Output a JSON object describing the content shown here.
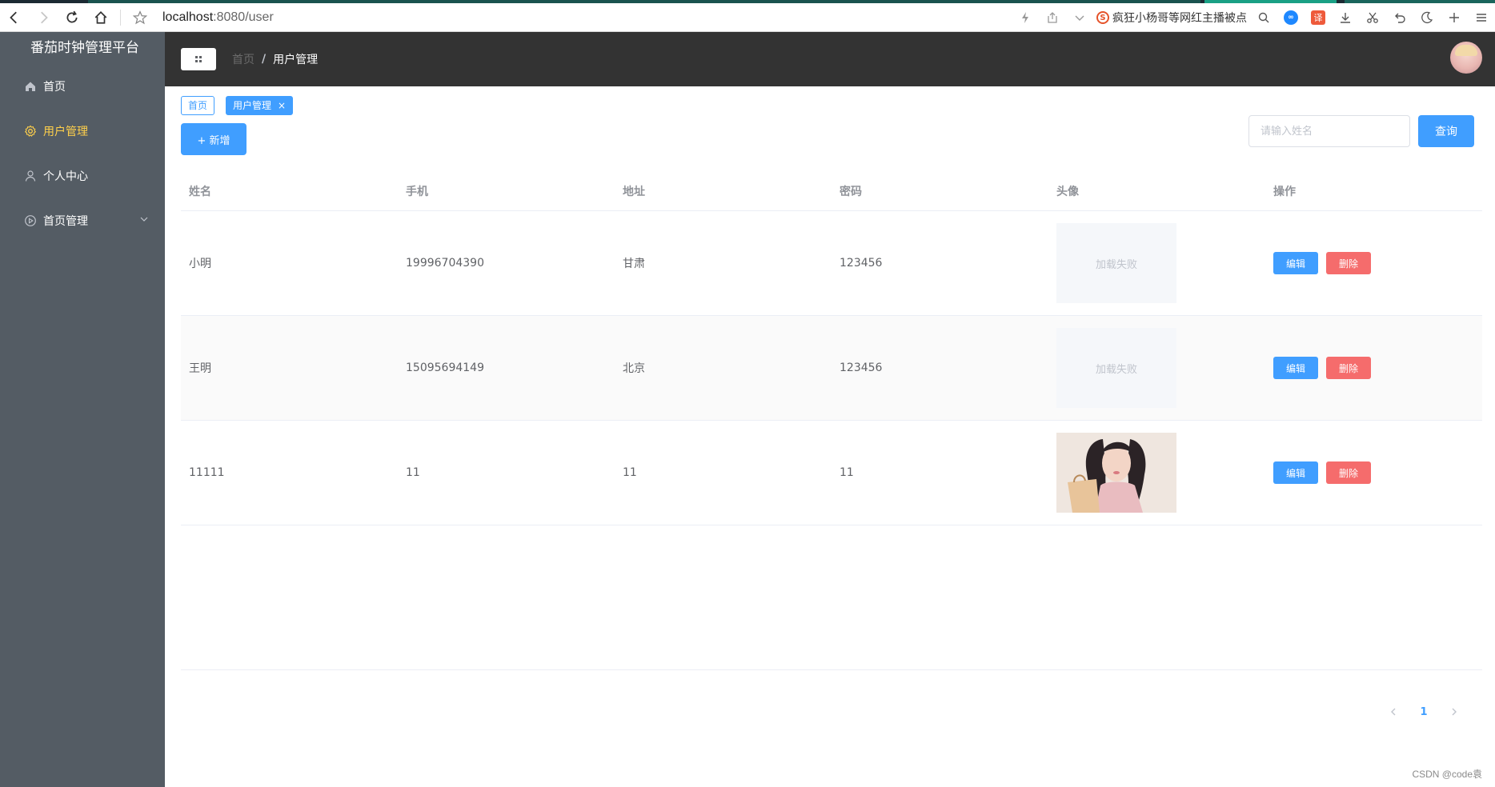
{
  "browser": {
    "url_host": "localhost",
    "url_path": ":8080/user",
    "search_snippet": "疯狂小杨哥等网红主播被点",
    "sogou_letter": "S",
    "translate_label": "译",
    "infinity_label": "∞"
  },
  "sidebar": {
    "title": "番茄时钟管理平台",
    "items": [
      {
        "label": "首页",
        "icon": "home-icon",
        "active": false
      },
      {
        "label": "用户管理",
        "icon": "gear-icon",
        "active": true
      },
      {
        "label": "个人中心",
        "icon": "user-icon",
        "active": false
      },
      {
        "label": "首页管理",
        "icon": "play-circle-icon",
        "active": false,
        "has_submenu": true
      }
    ],
    "bg": "#545c64",
    "active_color": "#ffd04b"
  },
  "header": {
    "breadcrumb_home": "首页",
    "breadcrumb_separator": "/",
    "breadcrumb_current": "用户管理",
    "bg": "#333333"
  },
  "tags": {
    "home": "首页",
    "current": "用户管理",
    "close_glyph": "×"
  },
  "toolbar": {
    "add_label": "+ 新增",
    "search_placeholder": "请输入姓名",
    "search_value": "",
    "query_label": "查询"
  },
  "table": {
    "headers": [
      "姓名",
      "手机",
      "地址",
      "密码",
      "头像",
      "操作"
    ],
    "rows": [
      {
        "name": "小明",
        "phone": "19996704390",
        "address": "甘肃",
        "password": "123456",
        "avatar_text": "加载失败",
        "avatar_loaded": false
      },
      {
        "name": "王明",
        "phone": "15095694149",
        "address": "北京",
        "password": "123456",
        "avatar_text": "加载失败",
        "avatar_loaded": false
      },
      {
        "name": "11111",
        "phone": "11",
        "address": "11",
        "password": "11",
        "avatar_text": "",
        "avatar_loaded": true
      }
    ],
    "edit_label": "编辑",
    "delete_label": "删除"
  },
  "pagination": {
    "current_page": "1"
  },
  "colors": {
    "primary": "#409eff",
    "danger": "#f56c6c"
  },
  "watermark": "CSDN @code袁"
}
